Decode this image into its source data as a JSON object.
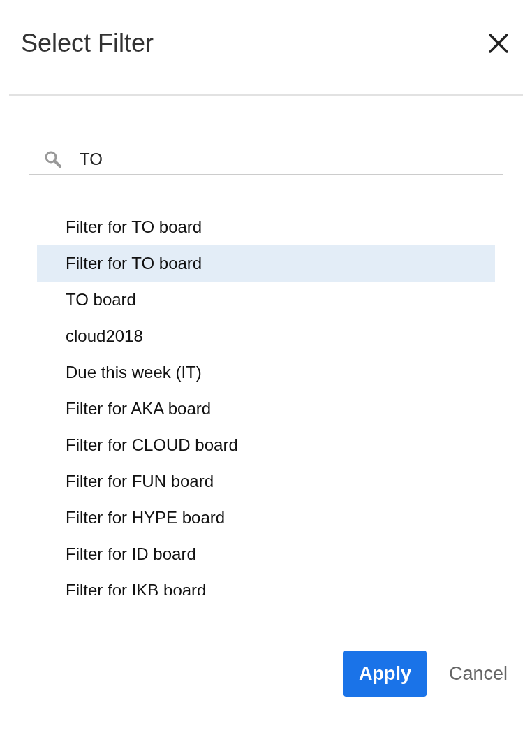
{
  "dialog": {
    "title": "Select Filter"
  },
  "search": {
    "value": "TO"
  },
  "filters": [
    {
      "label": "Filter for TO board",
      "selected": false
    },
    {
      "label": "Filter for TO board",
      "selected": true
    },
    {
      "label": "TO board",
      "selected": false
    },
    {
      "label": "cloud2018",
      "selected": false
    },
    {
      "label": "Due this week (IT)",
      "selected": false
    },
    {
      "label": "Filter for AKA board",
      "selected": false
    },
    {
      "label": "Filter for CLOUD board",
      "selected": false
    },
    {
      "label": "Filter for FUN board",
      "selected": false
    },
    {
      "label": "Filter for HYPE board",
      "selected": false
    },
    {
      "label": "Filter for ID board",
      "selected": false
    },
    {
      "label": "Filter for IKB board",
      "selected": false
    }
  ],
  "buttons": [
    {
      "label": "Apply",
      "kind": "primary"
    },
    {
      "label": "Cancel",
      "kind": "secondary"
    }
  ]
}
